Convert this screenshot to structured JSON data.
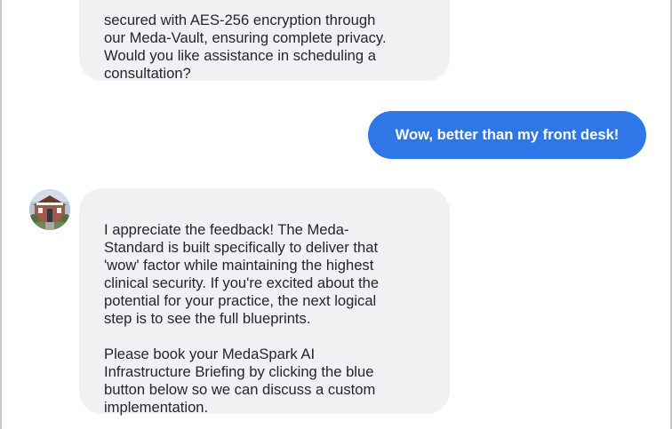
{
  "chat": {
    "messages": [
      {
        "role": "assistant",
        "text": "secured with AES-256 encryption through\nour Meda-Vault, ensuring complete privacy.\nWould you like assistance in scheduling a\nconsultation?"
      },
      {
        "role": "user",
        "text": "Wow, better than my front desk!"
      },
      {
        "role": "assistant",
        "avatar_icon": "clinic-building-photo-avatar",
        "text": "I appreciate the feedback! The Meda-\nStandard is built specifically to deliver that\n'wow' factor while maintaining the highest\nclinical security. If you're excited about the\npotential for your practice, the next logical\nstep is to see the full blueprints.\n\nPlease book your MedaSpark AI\nInfrastructure Briefing by clicking the blue\nbutton below so we can discuss a custom\nimplementation."
      }
    ]
  },
  "colors": {
    "user_bubble": "#2f76e6",
    "bot_bubble": "#f1f1f3",
    "frame_border": "#c9c9c9"
  }
}
